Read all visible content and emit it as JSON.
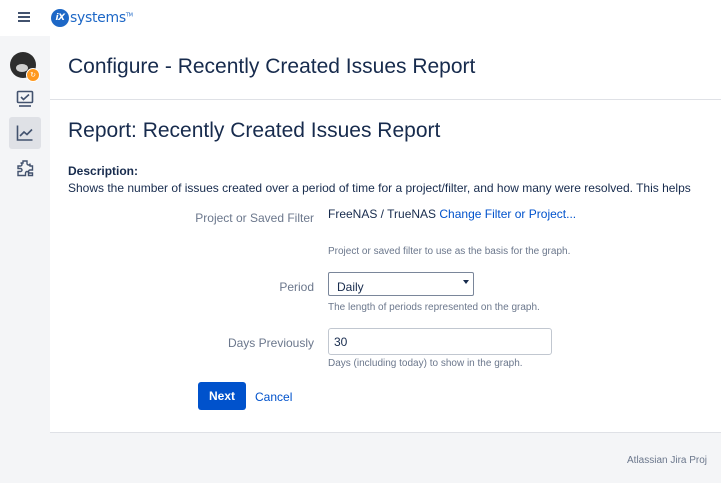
{
  "topbar": {
    "logo_mark": "iX",
    "logo_text": "systems"
  },
  "sidebar": {
    "items": [
      {
        "icon": "avatar"
      },
      {
        "icon": "board-icon"
      },
      {
        "icon": "reports-icon",
        "active": true
      },
      {
        "icon": "add-ons-icon"
      }
    ]
  },
  "header": {
    "title": "Configure - Recently Created Issues Report"
  },
  "report": {
    "title": "Report: Recently Created Issues Report",
    "description_label": "Description:",
    "description": "Shows the number of issues created over a period of time for a project/filter, and how many were resolved. This helps"
  },
  "form": {
    "filter": {
      "label": "Project or Saved Filter",
      "value": "FreeNAS / TrueNAS",
      "link": "Change Filter or Project...",
      "hint": "Project or saved filter to use as the basis for the graph."
    },
    "period": {
      "label": "Period",
      "value": "Daily",
      "hint": "The length of periods represented on the graph."
    },
    "days": {
      "label": "Days Previously",
      "value": "30",
      "hint": "Days (including today) to show in the graph."
    },
    "next_label": "Next",
    "cancel_label": "Cancel"
  },
  "footer": {
    "text": "Atlassian Jira Proj"
  },
  "colors": {
    "primary": "#0052cc",
    "brand": "#1d67c6",
    "text": "#172b4d",
    "muted": "#6b778c"
  }
}
